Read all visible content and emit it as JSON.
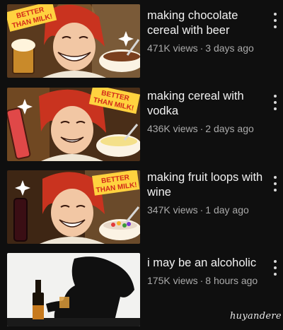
{
  "feed": {
    "videos": [
      {
        "title": "making chocolate cereal with beer",
        "views": "471K views",
        "age": "3 days ago",
        "badge": "BETTER THAN MILK!",
        "badge_line1": "BETTER",
        "badge_line2": "THAN MILK!"
      },
      {
        "title": "making cereal with vodka",
        "views": "436K views",
        "age": "2 days ago",
        "badge": "BETTER THAN MILK!",
        "badge_line1": "BETTER",
        "badge_line2": "THAN MILK!"
      },
      {
        "title": "making fruit loops with wine",
        "views": "347K views",
        "age": "1 day ago",
        "badge": "BETTER THAN MILK!",
        "badge_line1": "BETTER",
        "badge_line2": "THAN MILK!"
      },
      {
        "title": "i may be an alcoholic",
        "views": "175K views",
        "age": "8 hours ago"
      }
    ],
    "separator": "·",
    "signature": "huyandere"
  },
  "colors": {
    "background": "#0f0f0f",
    "title_text": "#f1f1f1",
    "meta_text": "#aaaaaa",
    "hair_red": "#c9331f",
    "badge_yellow": "#ffd23f",
    "badge_text": "#d22a1a"
  }
}
